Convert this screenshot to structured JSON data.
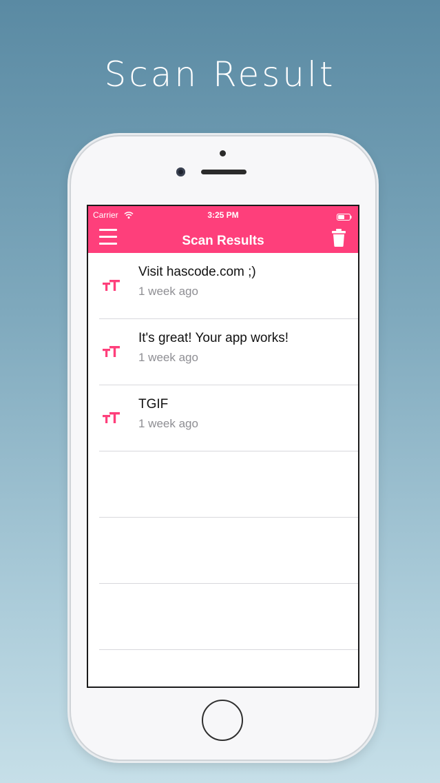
{
  "headline": "Scan Result",
  "status_bar": {
    "carrier": "Carrier",
    "time": "3:25 PM"
  },
  "navbar": {
    "title": "Scan Results",
    "color": "#fe3f7b",
    "left_icon": "menu-icon",
    "right_icon": "trash-icon"
  },
  "results": [
    {
      "text": "Visit hascode.com ;)",
      "time": "1 week ago",
      "icon": "text-type-icon"
    },
    {
      "text": "It's great! Your app works!",
      "time": "1 week ago",
      "icon": "text-type-icon"
    },
    {
      "text": "TGIF",
      "time": "1 week ago",
      "icon": "text-type-icon"
    },
    {
      "text": "",
      "time": ""
    },
    {
      "text": "",
      "time": ""
    },
    {
      "text": "",
      "time": ""
    }
  ]
}
